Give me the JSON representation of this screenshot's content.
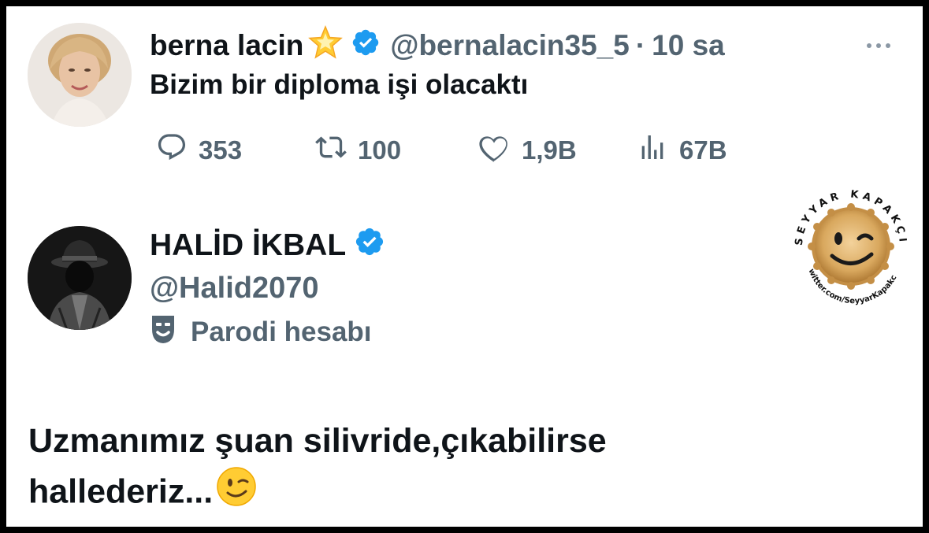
{
  "tweet1": {
    "name": "berna lacin",
    "handle": "@bernalacin35_5",
    "separator": "·",
    "time": "10 sa",
    "text": "Bizim bir diploma işi olacaktı",
    "stats": {
      "replies": "353",
      "retweets": "100",
      "likes": "1,9B",
      "views": "67B"
    }
  },
  "profile": {
    "name": "HALİD İKBAL",
    "handle": "@Halid2070",
    "parody_label": "Parodi hesabı"
  },
  "reply_text_line1": "Uzmanımız şuan silivride,çıkabilirse",
  "reply_text_line2": "hallederiz...",
  "watermark": {
    "top_text": "SEYYAR KAPAKÇI",
    "bottom_text": "twitter.com/SeyyarKapakci"
  },
  "colors": {
    "verified": "#1d9bf0",
    "text": "#0f1419",
    "muted": "#536471"
  },
  "icons": [
    "star-icon",
    "verified-badge-icon",
    "more-icon",
    "reply-icon",
    "retweet-icon",
    "like-icon",
    "views-icon",
    "parody-mask-icon",
    "wink-emoji-icon"
  ]
}
